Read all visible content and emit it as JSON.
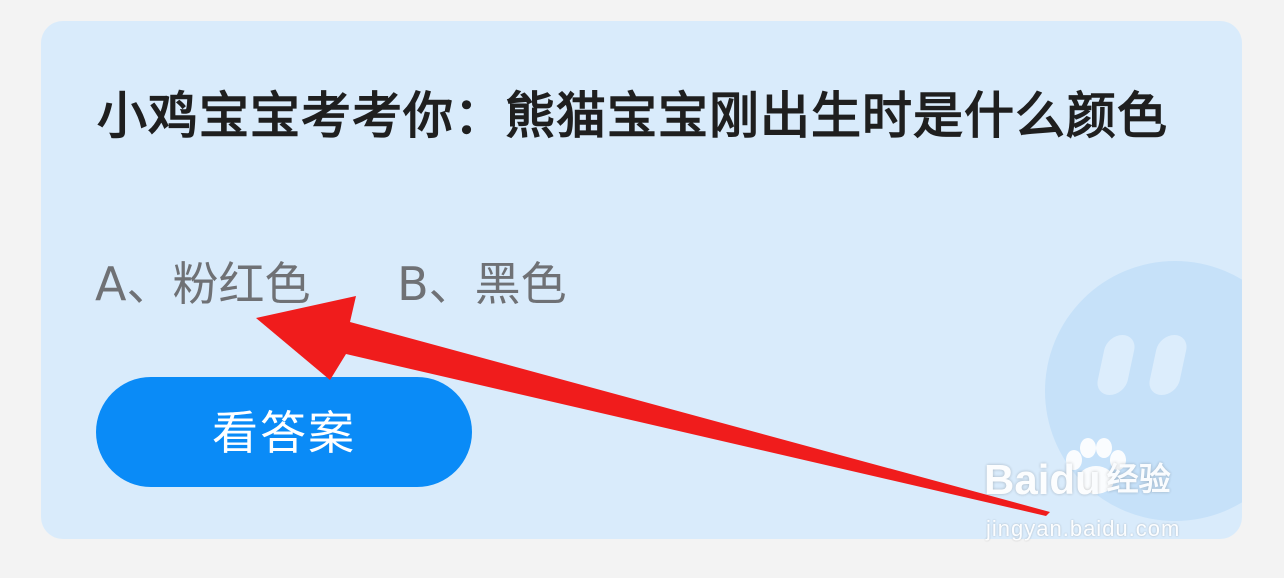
{
  "quiz": {
    "question": "小鸡宝宝考考你：熊猫宝宝刚出生时是什么颜色",
    "option_a": "A、粉红色",
    "option_b": "B、黑色",
    "answer_button_label": "看答案"
  },
  "watermark": {
    "logo_text": "Baidu",
    "logo_cn": "经验",
    "url": "jingyan.baidu.com"
  },
  "colors": {
    "background": "#f3f3f3",
    "card": "#d9ebfb",
    "button": "#0a8bf7",
    "arrow": "#f01c1c",
    "question_text": "#1f1f1f",
    "option_text": "#6f7175"
  },
  "icons": {
    "mascot": "mascot-face-icon",
    "annotation": "red-arrow-icon",
    "watermark_paw": "paw-icon"
  }
}
